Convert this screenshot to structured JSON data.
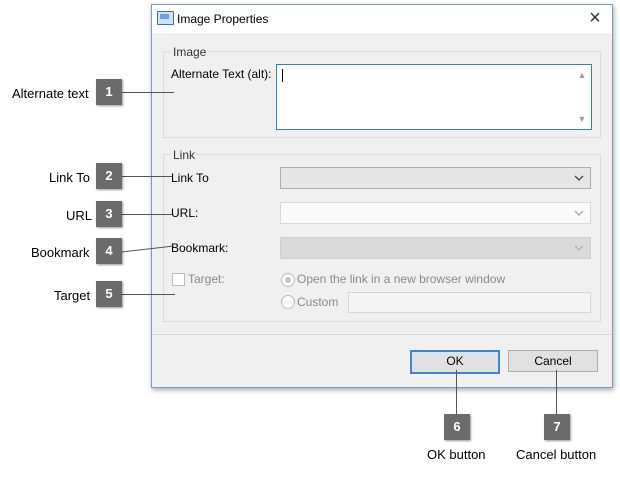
{
  "dialog": {
    "title": "Image Properties",
    "close_glyph": "×",
    "image_group": {
      "label": "Image",
      "alt_label": "Alternate Text (alt):",
      "alt_value": ""
    },
    "link_group": {
      "label": "Link",
      "link_to_label": "Link To",
      "link_to_value": "",
      "url_label": "URL:",
      "url_value": "",
      "bookmark_label": "Bookmark:",
      "bookmark_value": "",
      "target_label": "Target:",
      "target_options": [
        "Open the link in a new browser window",
        "Custom"
      ],
      "target_selected": "Open the link in a new browser window",
      "custom_value": ""
    },
    "buttons": {
      "ok": "OK",
      "cancel": "Cancel"
    }
  },
  "callouts": [
    {
      "num": "1",
      "text": "Alternate text"
    },
    {
      "num": "2",
      "text": "Link To"
    },
    {
      "num": "3",
      "text": "URL"
    },
    {
      "num": "4",
      "text": "Bookmark"
    },
    {
      "num": "5",
      "text": "Target"
    },
    {
      "num": "6",
      "text": "OK button"
    },
    {
      "num": "7",
      "text": "Cancel button"
    }
  ],
  "icons": {
    "app": "image-properties-icon",
    "close": "close-icon",
    "dropdown": "chevron-down-icon"
  },
  "colors": {
    "dialog_bg": "#f0f0f0",
    "accent_blue": "#3d86cf",
    "badge": "#6b6b6b"
  }
}
